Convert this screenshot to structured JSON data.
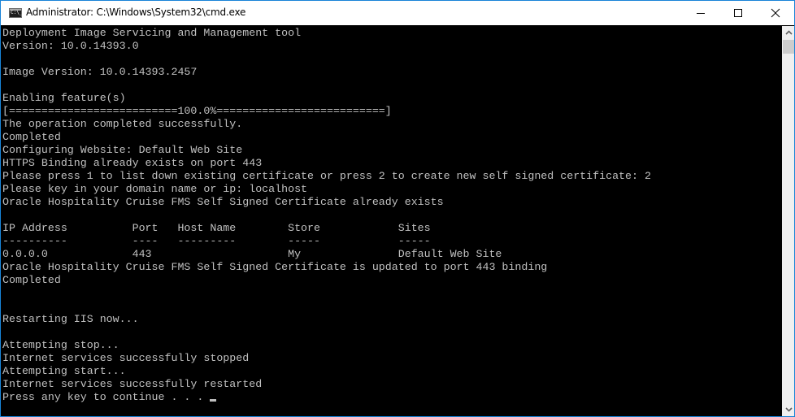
{
  "window": {
    "title": "Administrator: C:\\Windows\\System32\\cmd.exe",
    "icon": "cmd-console-icon",
    "controls": {
      "minimize": "minimize-icon",
      "maximize": "maximize-icon",
      "close": "close-icon"
    },
    "border_color": "#1883d7"
  },
  "console": {
    "background": "#000000",
    "foreground": "#c0c0c0",
    "lines": [
      "Deployment Image Servicing and Management tool",
      "Version: 10.0.14393.0",
      "",
      "Image Version: 10.0.14393.2457",
      "",
      "Enabling feature(s)",
      "[==========================100.0%==========================]",
      "The operation completed successfully.",
      "Completed",
      "Configuring Website: Default Web Site",
      "HTTPS Binding already exists on port 443",
      "Please press 1 to list down existing certificate or press 2 to create new self signed certificate: 2",
      "Please key in your domain name or ip: localhost",
      "Oracle Hospitality Cruise FMS Self Signed Certificate already exists",
      "",
      "IP Address          Port   Host Name        Store            Sites",
      "----------          ----   ---------        -----            -----",
      "0.0.0.0             443                     My               Default Web Site",
      "Oracle Hospitality Cruise FMS Self Signed Certificate is updated to port 443 binding",
      "Completed",
      "",
      "",
      "Restarting IIS now...",
      "",
      "Attempting stop...",
      "Internet services successfully stopped",
      "Attempting start...",
      "Internet services successfully restarted",
      "Press any key to continue . . . "
    ],
    "progress": {
      "percent": 100.0,
      "label": "100.0%"
    },
    "binding_table": {
      "columns": [
        "IP Address",
        "Port",
        "Host Name",
        "Store",
        "Sites"
      ],
      "rows": [
        [
          "0.0.0.0",
          "443",
          "",
          "My",
          "Default Web Site"
        ]
      ]
    },
    "prompt": "Press any key to continue . . . ",
    "cursor": "block-underline-cursor"
  },
  "scrollbar": {
    "up_icon": "chevron-up-icon",
    "down_icon": "chevron-down-icon",
    "position": "top"
  }
}
